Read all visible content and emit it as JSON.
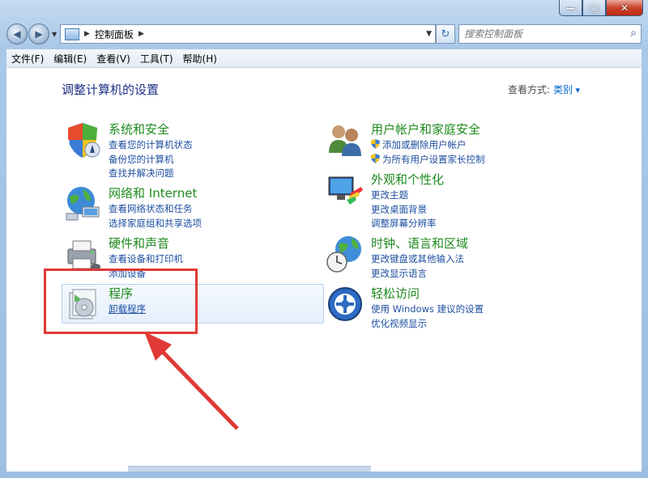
{
  "window": {
    "minimize": "—",
    "maximize": "□",
    "close": "✕"
  },
  "nav": {
    "back_icon": "arrow-left-icon",
    "forward_icon": "arrow-right-icon",
    "address_root": "控制面板",
    "refresh_icon": "refresh-icon",
    "search_placeholder": "搜索控制面板"
  },
  "menu": {
    "items": [
      "文件(F)",
      "编辑(E)",
      "查看(V)",
      "工具(T)",
      "帮助(H)"
    ]
  },
  "content": {
    "heading": "调整计算机的设置",
    "view_by_label": "查看方式:",
    "view_by_value": "类别"
  },
  "categories": {
    "system": {
      "title": "系统和安全",
      "links": [
        "查看您的计算机状态",
        "备份您的计算机",
        "查找并解决问题"
      ]
    },
    "network": {
      "title": "网络和 Internet",
      "links": [
        "查看网络状态和任务",
        "选择家庭组和共享选项"
      ]
    },
    "hardware": {
      "title": "硬件和声音",
      "links": [
        "查看设备和打印机",
        "添加设备"
      ]
    },
    "programs": {
      "title": "程序",
      "links": [
        "卸载程序"
      ]
    },
    "users": {
      "title": "用户帐户和家庭安全",
      "links": [
        "添加或删除用户帐户",
        "为所有用户设置家长控制"
      ]
    },
    "appearance": {
      "title": "外观和个性化",
      "links": [
        "更改主题",
        "更改桌面背景",
        "调整屏幕分辨率"
      ]
    },
    "clock": {
      "title": "时钟、语言和区域",
      "links": [
        "更改键盘或其他输入法",
        "更改显示语言"
      ]
    },
    "ease": {
      "title": "轻松访问",
      "links": [
        "使用 Windows 建议的设置",
        "优化视频显示"
      ]
    }
  },
  "colors": {
    "title_green": "#1e8a1e",
    "link_blue": "#1e4ea0",
    "highlight_red": "#e03a36"
  }
}
